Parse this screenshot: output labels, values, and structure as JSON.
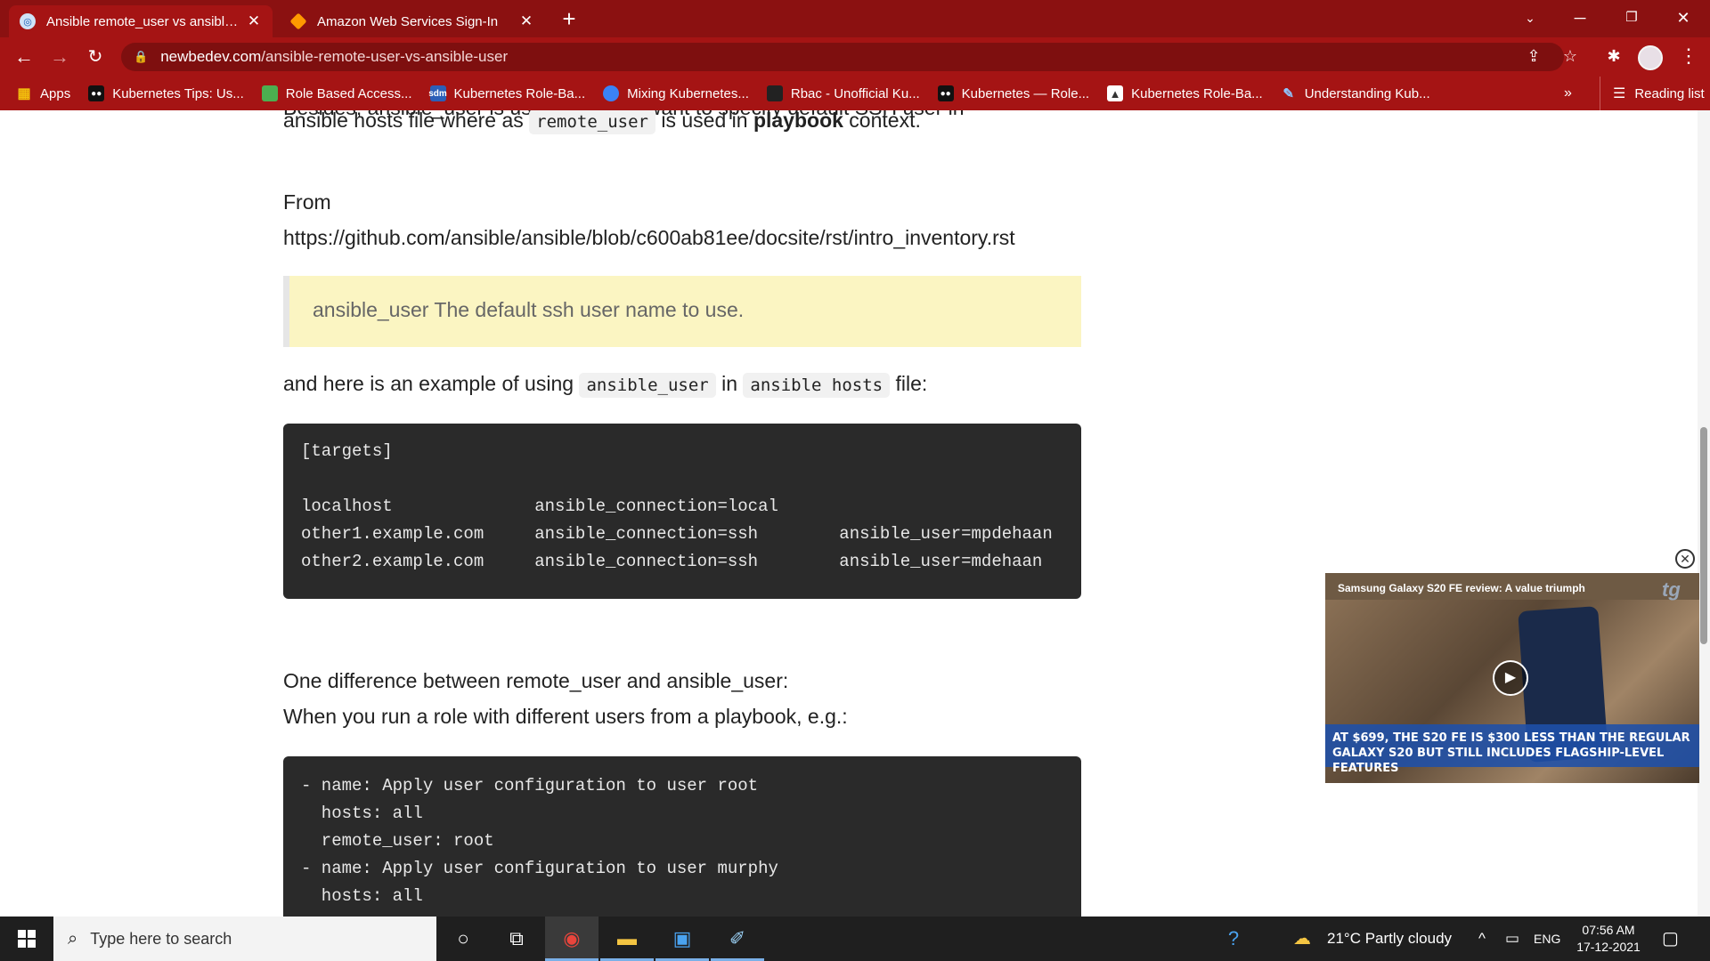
{
  "tabs": [
    {
      "title": "Ansible remote_user vs ansible_u",
      "active": true
    },
    {
      "title": "Amazon Web Services Sign-In",
      "active": false
    }
  ],
  "address": {
    "host": "newbedev.com",
    "path": "/ansible-remote-user-vs-ansible-user"
  },
  "bookmarks": [
    {
      "label": "Apps",
      "icon": "apps-grid-icon"
    },
    {
      "label": "Kubernetes Tips: Us...",
      "icon": "medium-icon"
    },
    {
      "label": "Role Based Access...",
      "icon": "image-icon"
    },
    {
      "label": "Kubernetes Role-Ba...",
      "icon": "sdm-icon"
    },
    {
      "label": "Mixing Kubernetes...",
      "icon": "person-icon"
    },
    {
      "label": "Rbac - Unofficial Ku...",
      "icon": "book-icon"
    },
    {
      "label": "Kubernetes — Role...",
      "icon": "medium-icon"
    },
    {
      "label": "Kubernetes Role-Ba...",
      "icon": "triangle-icon"
    },
    {
      "label": "Understanding Kub...",
      "icon": "feather-icon"
    }
  ],
  "reading_list": "Reading list",
  "article": {
    "cut_line": "Besides, ansible_user is used when we want to specify default SSH user in",
    "p1_pre": "ansible hosts file where as ",
    "p1_code": "remote_user",
    "p1_mid": " is used in ",
    "p1_bold": "playbook",
    "p1_post": " context.",
    "from_label": "From",
    "from_url": "https://github.com/ansible/ansible/blob/c600ab81ee/docsite/rst/intro_inventory.rst",
    "quote": "ansible_user The default ssh user name to use.",
    "p2_pre": "and here is an example of using ",
    "p2_code1": "ansible_user",
    "p2_mid": " in ",
    "p2_code2": "ansible hosts",
    "p2_post": " file:",
    "code1": [
      "[targets]",
      "",
      "localhost              ansible_connection=local",
      "other1.example.com     ansible_connection=ssh        ansible_user=mpdehaan",
      "other2.example.com     ansible_connection=ssh        ansible_user=mdehaan"
    ],
    "p3": "One difference between remote_user and ansible_user:",
    "p4": "When you run a role with different users from a playbook, e.g.:",
    "code2": [
      "- name: Apply user configuration to user root",
      "  hosts: all",
      "  remote_user: root",
      "- name: Apply user configuration to user murphy",
      "  hosts: all"
    ]
  },
  "ad": {
    "title": "Samsung Galaxy S20 FE review: A value triumph",
    "brand": "tg",
    "banner": "AT $699, THE S20 FE IS $300 LESS THAN THE REGULAR GALAXY S20 BUT STILL INCLUDES FLAGSHIP-LEVEL FEATURES"
  },
  "taskbar": {
    "search_placeholder": "Type here to search",
    "weather": "21°C  Partly cloudy",
    "lang": "ENG",
    "time": "07:56 AM",
    "date": "17-12-2021"
  }
}
